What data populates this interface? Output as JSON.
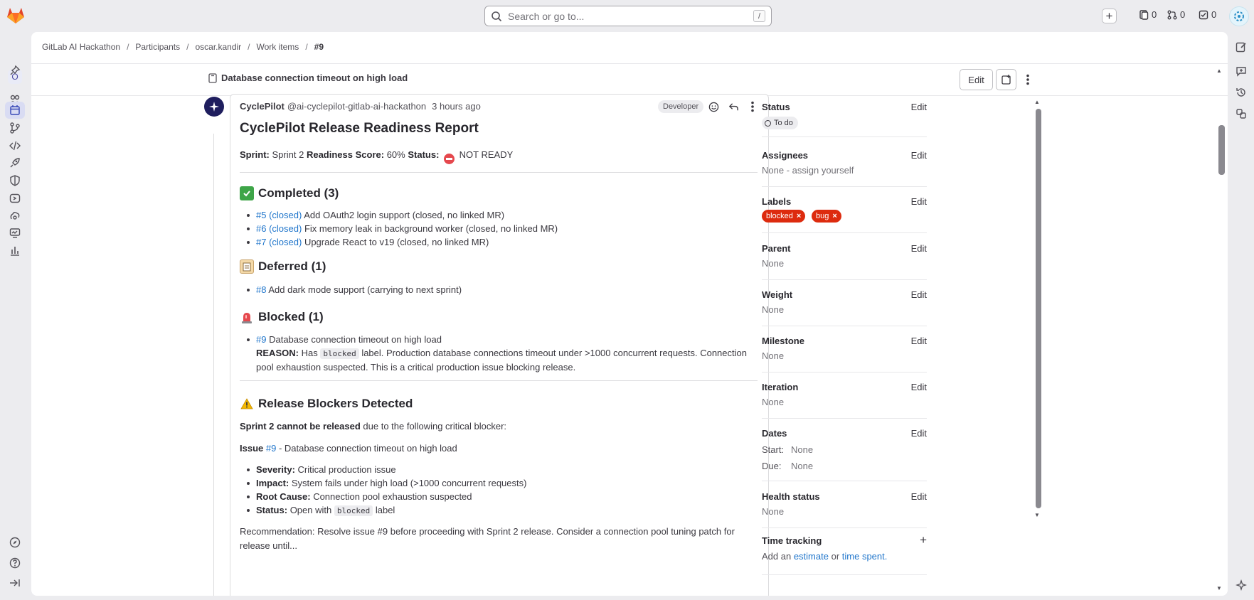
{
  "topbar": {
    "search_placeholder": "Search or go to...",
    "search_shortcut": "/",
    "issues_count": "0",
    "merge_requests_count": "0",
    "todos_count": "0"
  },
  "left_rail": {
    "org_initial": "O"
  },
  "breadcrumb": {
    "items": [
      "GitLab AI Hackathon",
      "Participants",
      "oscar.kandir",
      "Work items",
      "#9"
    ]
  },
  "work_item": {
    "title": "Database connection timeout on high load",
    "edit_label": "Edit"
  },
  "note": {
    "author_name": "CyclePilot",
    "author_handle": "@ai-cyclepilot-gitlab-ai-hackathon",
    "time_ago": "3 hours ago",
    "role": "Developer",
    "report_title": "CyclePilot Release Readiness Report",
    "summary": {
      "sprint_label": "Sprint:",
      "sprint_value": "Sprint 2",
      "score_label": "Readiness Score:",
      "score_value": "60%",
      "status_label": "Status:",
      "status_value": "NOT READY"
    },
    "completed": {
      "heading": "Completed (3)",
      "items": [
        {
          "ref": "#5 (closed)",
          "text": "Add OAuth2 login support (closed, no linked MR)"
        },
        {
          "ref": "#6 (closed)",
          "text": "Fix memory leak in background worker (closed, no linked MR)"
        },
        {
          "ref": "#7 (closed)",
          "text": "Upgrade React to v19 (closed, no linked MR)"
        }
      ]
    },
    "deferred": {
      "heading": "Deferred (1)",
      "items": [
        {
          "ref": "#8",
          "text": "Add dark mode support (carrying to next sprint)"
        }
      ]
    },
    "blocked": {
      "heading": "Blocked (1)",
      "item_ref": "#9",
      "item_text": "Database connection timeout on high load",
      "reason_label": "REASON:",
      "reason_pre": "Has",
      "reason_code": "blocked",
      "reason_post": "label. Production database connections timeout under >1000 concurrent requests. Connection pool exhaustion suspected. This is a critical production issue blocking release."
    },
    "blockers": {
      "heading": "Release Blockers Detected",
      "intro_bold": "Sprint 2 cannot be released",
      "intro_rest": "due to the following critical blocker:",
      "issue_label": "Issue",
      "issue_ref": "#9",
      "issue_text": "- Database connection timeout on high load",
      "details": [
        {
          "label": "Severity:",
          "value": "Critical production issue"
        },
        {
          "label": "Impact:",
          "value": "System fails under high load (>1000 concurrent requests)"
        },
        {
          "label": "Root Cause:",
          "value": "Connection pool exhaustion suspected"
        }
      ],
      "status_label": "Status:",
      "status_pre": "Open with",
      "status_code": "blocked",
      "status_post": "label"
    },
    "recommendation_partial": "Recommendation: Resolve issue #9 before proceeding with Sprint 2 release. Consider a connection pool tuning patch for release until..."
  },
  "sidebar": {
    "edit_label": "Edit",
    "status": {
      "title": "Status",
      "value": "To do"
    },
    "assignees": {
      "title": "Assignees",
      "value": "None - assign yourself"
    },
    "labels": {
      "title": "Labels",
      "items": [
        "blocked",
        "bug"
      ]
    },
    "parent": {
      "title": "Parent",
      "value": "None"
    },
    "weight": {
      "title": "Weight",
      "value": "None"
    },
    "milestone": {
      "title": "Milestone",
      "value": "None"
    },
    "iteration": {
      "title": "Iteration",
      "value": "None"
    },
    "dates": {
      "title": "Dates",
      "start_label": "Start:",
      "start_value": "None",
      "due_label": "Due:",
      "due_value": "None"
    },
    "health": {
      "title": "Health status",
      "value": "None"
    },
    "time_tracking": {
      "title": "Time tracking",
      "pre": "Add an",
      "estimate": "estimate",
      "or": "or",
      "spent": "time spent."
    }
  },
  "colors": {
    "accent": "#1f75cb",
    "label_red": "#dd2b0e",
    "bot_avatar": "#1f1e5e"
  }
}
